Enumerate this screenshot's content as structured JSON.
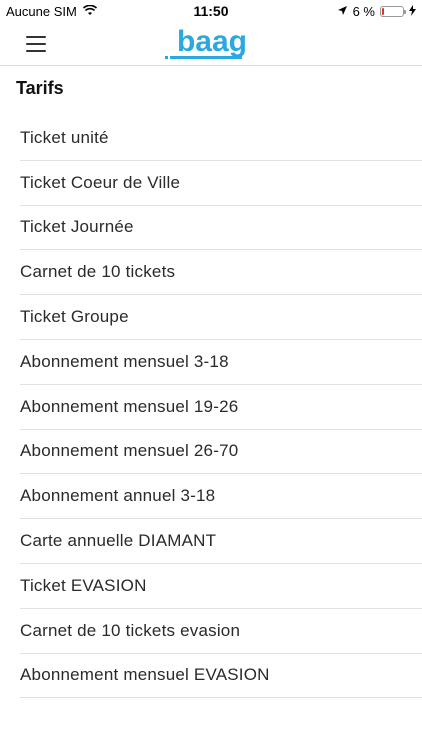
{
  "status_bar": {
    "carrier": "Aucune SIM",
    "time": "11:50",
    "battery_percent_text": "6 %",
    "battery_level": 0.06,
    "battery_color": "#e0302a"
  },
  "header": {
    "logo_text": "baag",
    "logo_color": "#2aa8e0",
    "menu_icon": "hamburger-icon"
  },
  "main": {
    "title": "Tarifs",
    "items": [
      {
        "label": "Ticket unité"
      },
      {
        "label": "Ticket Coeur de Ville"
      },
      {
        "label": "Ticket Journée"
      },
      {
        "label": "Carnet de 10 tickets"
      },
      {
        "label": "Ticket Groupe"
      },
      {
        "label": "Abonnement mensuel 3-18"
      },
      {
        "label": "Abonnement mensuel 19-26"
      },
      {
        "label": "Abonnement mensuel 26-70"
      },
      {
        "label": "Abonnement annuel 3-18"
      },
      {
        "label": "Carte annuelle DIAMANT"
      },
      {
        "label": "Ticket EVASION"
      },
      {
        "label": "Carnet de 10 tickets evasion"
      },
      {
        "label": "Abonnement mensuel EVASION"
      }
    ]
  }
}
